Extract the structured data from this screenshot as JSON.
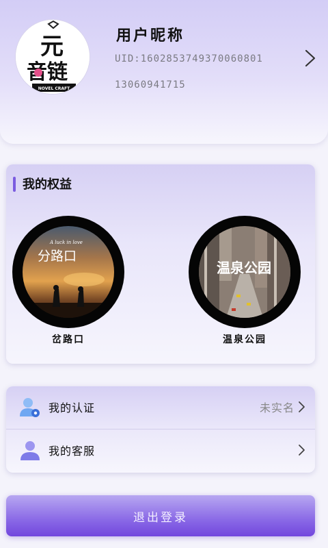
{
  "profile": {
    "nickname": "用户昵称",
    "uid": "UID:1602853749370060801",
    "phone": "13060941715",
    "avatar_logo": {
      "line1": "元",
      "line2": "音链",
      "brand": "NOVEL CRAFT"
    }
  },
  "benefits": {
    "title": "我的权益",
    "items": [
      {
        "label": "岔路口",
        "cover_title": "分路口",
        "cover_subtitle": "A luck in love"
      },
      {
        "label": "温泉公园",
        "cover_title": "温泉公园"
      }
    ]
  },
  "menu": {
    "items": [
      {
        "label": "我的认证",
        "value": "未实名",
        "icon": "verify-user-icon"
      },
      {
        "label": "我的客服",
        "value": "",
        "icon": "service-user-icon"
      }
    ]
  },
  "logout_label": "退出登录",
  "colors": {
    "accent": "#7b5ce0",
    "logout_button": "#8a69e6",
    "verify_icon": "#6fa7f2",
    "service_icon": "#7e7be8"
  }
}
